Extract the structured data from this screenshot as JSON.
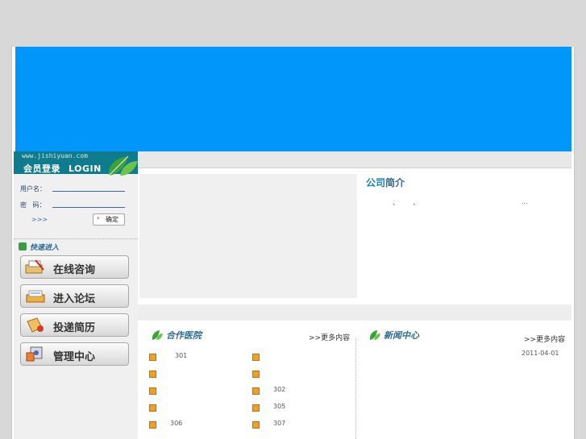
{
  "login": {
    "url": "www.jishiyuan.com",
    "title_cn": "会员登录",
    "title_en": "LOGIN",
    "username_label": "用户名：",
    "password_label": "密   码：",
    "register_link": ">>>",
    "submit_label": "确定"
  },
  "quick": {
    "title": "快速进入",
    "items": [
      {
        "label": "在线咨询",
        "icon": "consult-icon"
      },
      {
        "label": "进入论坛",
        "icon": "forum-icon"
      },
      {
        "label": "投递简历",
        "icon": "resume-icon"
      },
      {
        "label": "管理中心",
        "icon": "admin-icon"
      }
    ]
  },
  "about": {
    "title_a": "公司",
    "title_b": "简介",
    "text_1": "、",
    "text_2": "，",
    "text_3": "..."
  },
  "partners": {
    "title_a": "合作",
    "title_b": "医院",
    "more": ">>更多内容",
    "col1": [
      "301",
      "",
      "",
      "",
      "306"
    ],
    "col2": [
      "",
      "",
      "302",
      "305",
      "307"
    ]
  },
  "news": {
    "title_a": "新闻",
    "title_b": "中心",
    "more": ">>更多内容",
    "date": "2011-04-01"
  },
  "colors": {
    "banner": "#0096fa",
    "login_header": "#0f7c8e",
    "accent": "#2c6a90"
  }
}
